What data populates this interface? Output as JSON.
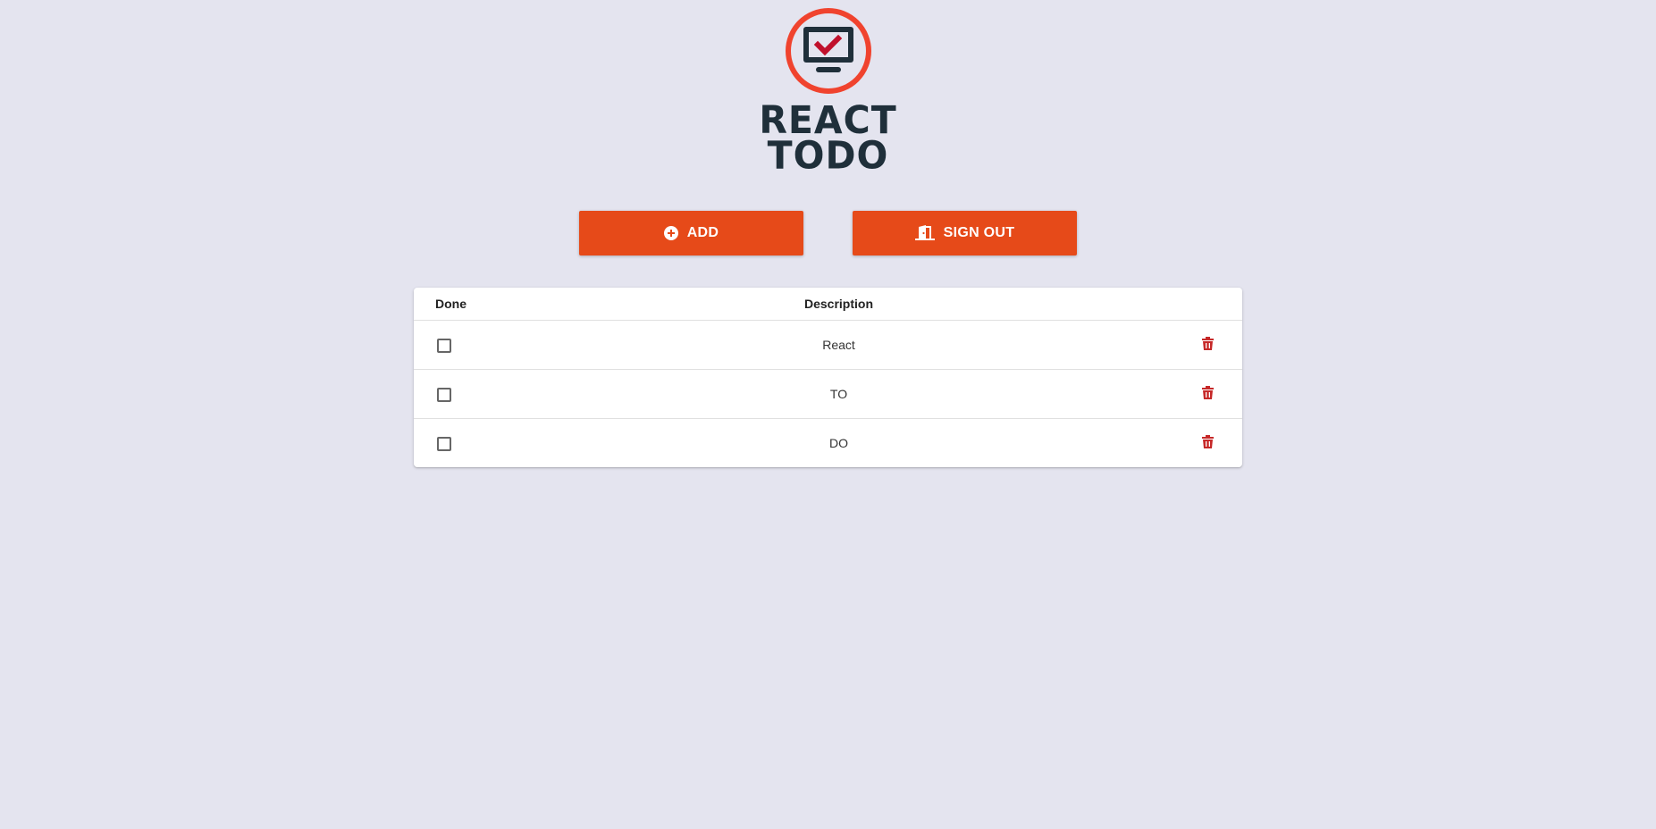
{
  "app": {
    "logo_line1": "REACT",
    "logo_line2": "TODO"
  },
  "colors": {
    "background": "#e4e4ef",
    "accent": "#e64a19",
    "logo_ring": "#f0432e",
    "logo_dark": "#1f2f3a",
    "logo_check": "#c0102c",
    "delete_icon": "#c62828"
  },
  "toolbar": {
    "add_label": "ADD",
    "add_icon": "plus-circle-icon",
    "signout_label": "SIGN OUT",
    "signout_icon": "door-exit-icon"
  },
  "table": {
    "headers": {
      "done": "Done",
      "description": "Description"
    },
    "rows": [
      {
        "done": false,
        "description": "React",
        "delete_icon": "trash-icon"
      },
      {
        "done": false,
        "description": "TO",
        "delete_icon": "trash-icon"
      },
      {
        "done": false,
        "description": "DO",
        "delete_icon": "trash-icon"
      }
    ]
  }
}
